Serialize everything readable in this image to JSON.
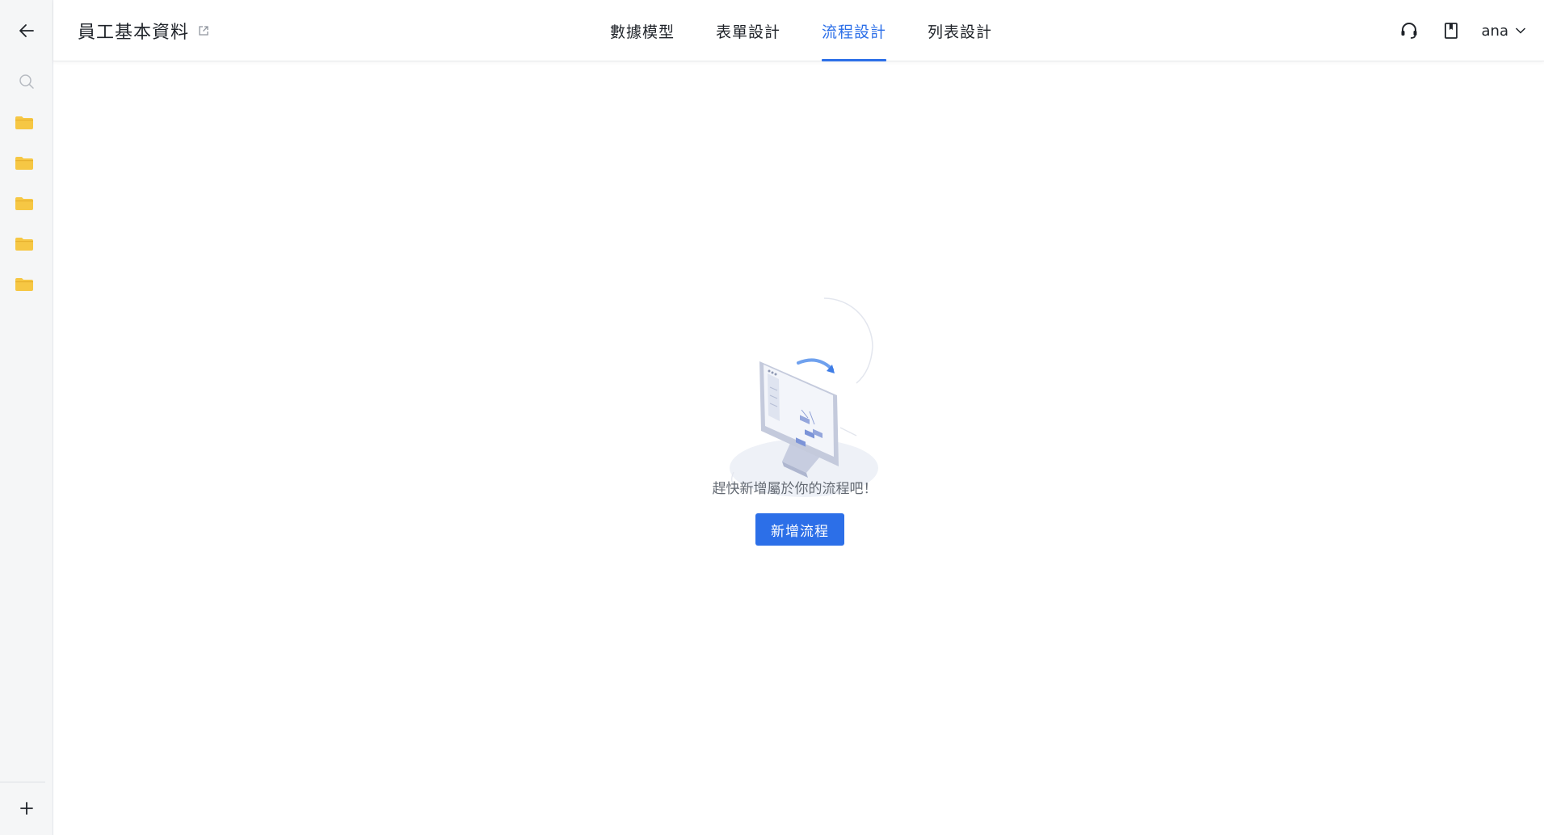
{
  "header": {
    "app_title": "員工基本資料",
    "tabs": [
      {
        "label": "數據模型",
        "active": false
      },
      {
        "label": "表單設計",
        "active": false
      },
      {
        "label": "流程設計",
        "active": true
      },
      {
        "label": "列表設計",
        "active": false
      }
    ],
    "user_name": "ana"
  },
  "sidebar": {
    "icons": [
      "back-arrow-icon",
      "search-icon",
      "folder-icon",
      "folder-icon",
      "folder-icon",
      "folder-icon",
      "folder-icon",
      "plus-icon"
    ],
    "folder_color": "#f6c744"
  },
  "empty_state": {
    "message": "趕快新增屬於你的流程吧！",
    "button_label": "新增流程"
  },
  "colors": {
    "accent": "#2c6fe8",
    "sidebar_bg": "#f5f6f7"
  }
}
